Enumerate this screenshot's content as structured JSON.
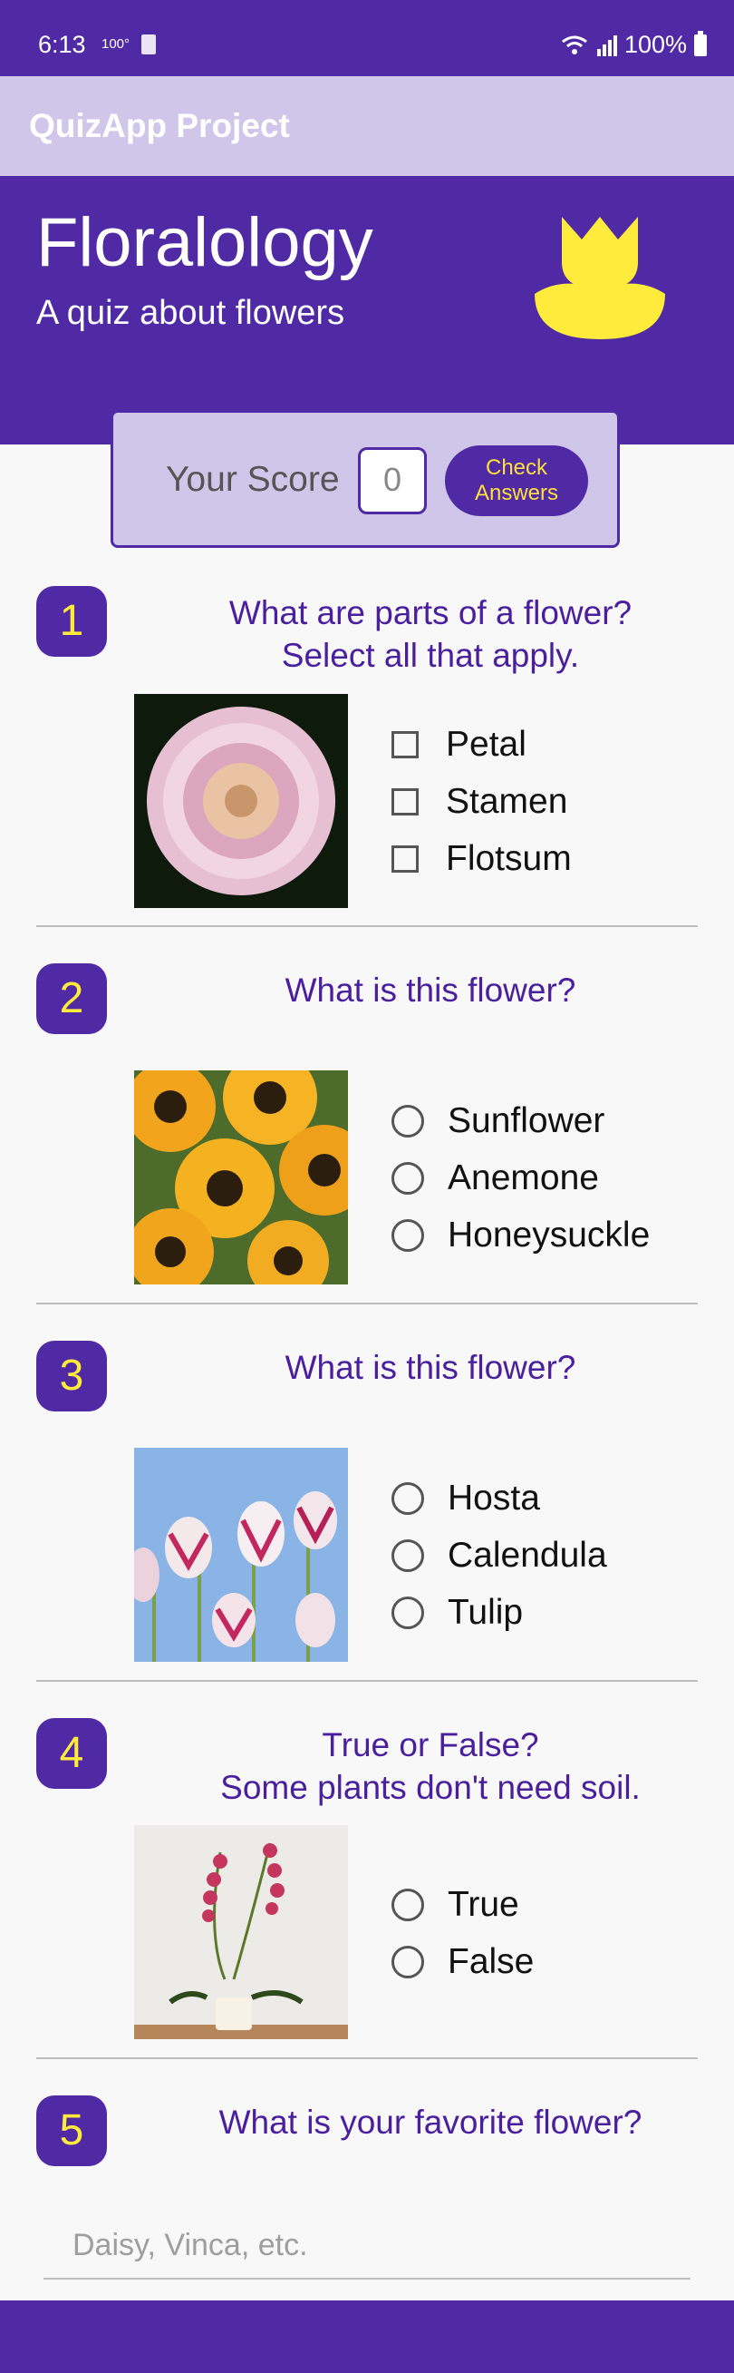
{
  "status": {
    "time": "6:13",
    "signal_text": "100°",
    "battery": "100%"
  },
  "appbar": {
    "title": "QuizApp Project"
  },
  "hero": {
    "title": "Floralology",
    "subtitle": "A quiz about flowers"
  },
  "score": {
    "label": "Your Score",
    "value": "0",
    "button_line1": "Check",
    "button_line2": "Answers"
  },
  "questions": [
    {
      "num": "1",
      "text_line1": "What are parts of a flower?",
      "text_line2": "Select all that apply.",
      "options": [
        "Petal",
        "Stamen",
        "Flotsum"
      ],
      "type": "checkbox"
    },
    {
      "num": "2",
      "text_line1": "What is this flower?",
      "options": [
        "Sunflower",
        "Anemone",
        "Honeysuckle"
      ],
      "type": "radio"
    },
    {
      "num": "3",
      "text_line1": "What is this flower?",
      "options": [
        "Hosta",
        "Calendula",
        "Tulip"
      ],
      "type": "radio"
    },
    {
      "num": "4",
      "text_line1": "True or False?",
      "text_line2": "Some plants don't need soil.",
      "options": [
        "True",
        "False"
      ],
      "type": "radio"
    },
    {
      "num": "5",
      "text_line1": "What is your favorite flower?",
      "placeholder": "Daisy, Vinca, etc.",
      "type": "text"
    }
  ],
  "colors": {
    "primary": "#4f2aa4",
    "accent": "#ffeb3b",
    "light": "#d0c6ea"
  }
}
